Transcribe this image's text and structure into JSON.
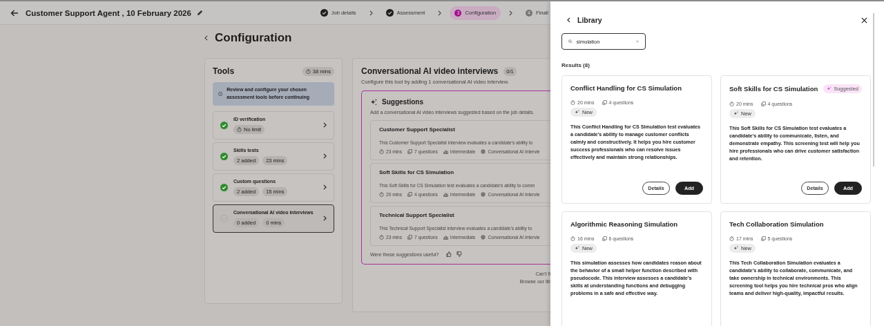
{
  "header": {
    "title": "Customer Support Agent , 10 February 2026",
    "steps": [
      {
        "label": "Job details",
        "done": true,
        "selected": false
      },
      {
        "label": "Assessment",
        "done": true,
        "selected": false
      },
      {
        "label": "Configuration",
        "number": "3",
        "done": false,
        "selected": true
      },
      {
        "label": "Finali",
        "number": "4",
        "done": false,
        "selected": false
      }
    ]
  },
  "page": {
    "title": "Configuration"
  },
  "tools": {
    "title": "Tools",
    "duration": "38 mins",
    "notice": "Review and configure your chosen assessment tools before continuing",
    "items": [
      {
        "name": "ID verification",
        "done": true,
        "selected": false,
        "tags": [
          {
            "text": "No limit",
            "timer": true
          }
        ]
      },
      {
        "name": "Skills tests",
        "done": true,
        "selected": false,
        "tags": [
          {
            "text": "2 added",
            "timer": false
          },
          {
            "text": "23 mins",
            "timer": false
          }
        ]
      },
      {
        "name": "Custom questions",
        "done": true,
        "selected": false,
        "tags": [
          {
            "text": "2 added",
            "timer": false
          },
          {
            "text": "15 mins",
            "timer": false
          }
        ]
      },
      {
        "name": "Conversational AI video interviews",
        "done": false,
        "selected": true,
        "tags": [
          {
            "text": "0 added",
            "timer": false
          },
          {
            "text": "0 mins",
            "timer": false
          }
        ]
      }
    ]
  },
  "interviews": {
    "title": "Conversational AI video interviews",
    "count": "0/1",
    "subtitle": "Configure this tool by adding 1 conversational AI video interview.",
    "suggestions": {
      "title": "Suggestions",
      "subtitle": "Add a conversational AI video interviews suggested based on the job details.",
      "items": [
        {
          "title": "Customer Support Specialist",
          "description": "This Customer Support Specialist interview evaluates a candidate's ability to",
          "duration": "23 mins",
          "questions": "7 questions",
          "level": "Intermediate",
          "type": "Conversational AI Intervie"
        },
        {
          "title": "Soft Skills for CS Simulation",
          "description": "This Soft Skills for CS Simulation test evaluates a candidate's ability to comm",
          "duration": "20 mins",
          "questions": "4 questions",
          "level": "Intermediate",
          "type": "Conversational AI Intervie"
        },
        {
          "title": "Technical Support Specialist",
          "description": "This Technical Support Specialist interview evaluates a candidate's ability to",
          "duration": "23 mins",
          "questions": "7 questions",
          "level": "Intermediate",
          "type": "Conversational AI Intervie"
        }
      ],
      "feedback": "Were these suggestions useful?"
    },
    "footer": [
      "Can't fi",
      "Browse our lib"
    ]
  },
  "library": {
    "title": "Library",
    "search": {
      "value": "simulation"
    },
    "results": "Results (8)",
    "cards": [
      {
        "title": "Conflict Handling for CS Simulation",
        "suggested": false,
        "duration": "20 mins",
        "questions": "4 questions",
        "tag": "New",
        "description": "This Conflict Handling for CS Simulation test evaluates a candidate's ability to manage customer conflicts calmly and constructively. It helps you hire customer success professionals who can resolve issues effectively and maintain strong relationships.",
        "actions": [
          "Details",
          "Add"
        ]
      },
      {
        "title": "Soft Skills for CS Simulation",
        "suggested": true,
        "badge": "Suggested",
        "duration": "20 mins",
        "questions": "4 questions",
        "tag": "New",
        "description": "This Soft Skills for CS Simulation test evaluates a candidate's ability to communicate, listen, and demonstrate empathy. This screening test will help you hire professionals who can drive customer satisfaction and retention.",
        "actions": [
          "Details",
          "Add"
        ]
      },
      {
        "title": "Algorithmic Reasoning Simulation",
        "suggested": false,
        "duration": "16 mins",
        "questions": "6 questions",
        "tag": "New",
        "description": "This simulation assesses how candidates reason about the behavior of a small helper function described with pseudocode. This interview assesses a candidate's skills at understanding functions and debugging problems in a safe and effective way."
      },
      {
        "title": "Tech Collaboration Simulation",
        "suggested": false,
        "duration": "17 mins",
        "questions": "5 questions",
        "tag": "New",
        "description": "This Tech Collaboration Simulation evaluates a candidate's ability to collaborate, communicate, and take ownership in technical environments. This screening tool helps you hire technical pros who align teams and deliver high-quality, impactful results."
      }
    ]
  }
}
